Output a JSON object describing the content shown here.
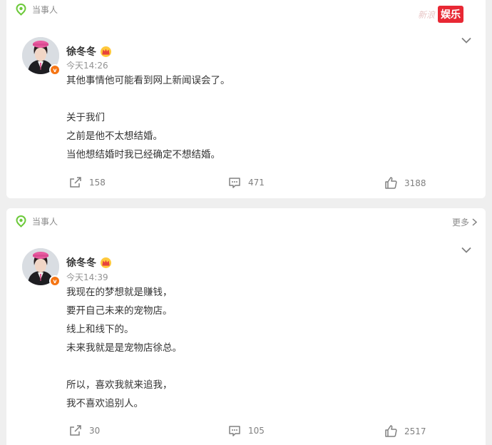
{
  "watermark": {
    "faint": "新浪",
    "badge": "娱乐"
  },
  "colors": {
    "tag_green": "#6cc93a",
    "badge_orange": "#f57514",
    "watermark_red": "#e82834"
  },
  "posts": [
    {
      "tag": "当事人",
      "tag_icon": "location-pin-icon",
      "author": "徐冬冬",
      "author_badge": "v",
      "crown_icon": "crown-icon",
      "time": "今天14:26",
      "lines": [
        "其他事情他可能看到网上新闻误会了。",
        "",
        "关于我们",
        "之前是他不太想结婚。",
        "当他想结婚时我已经确定不想结婚。"
      ],
      "reposts": "158",
      "comments": "471",
      "likes": "3188"
    },
    {
      "tag": "当事人",
      "tag_icon": "location-pin-icon",
      "more": "更多",
      "author": "徐冬冬",
      "author_badge": "v",
      "crown_icon": "crown-icon",
      "time": "今天14:39",
      "lines": [
        "我现在的梦想就是赚钱，",
        "要开自己未来的宠物店。",
        "线上和线下的。",
        "未来我就是是宠物店徐总。",
        "",
        "所以，喜欢我就来追我，",
        "我不喜欢追别人。"
      ],
      "reposts": "30",
      "comments": "105",
      "likes": "2517"
    }
  ]
}
